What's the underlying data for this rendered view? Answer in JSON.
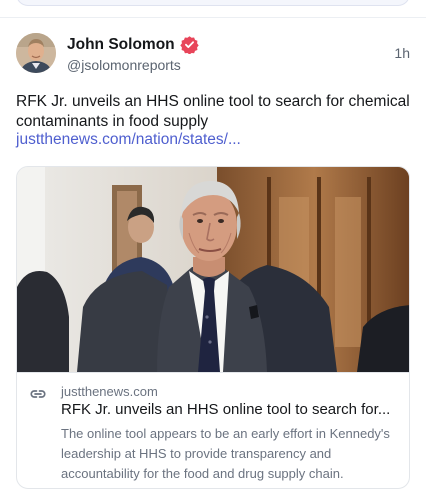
{
  "post": {
    "author_name": "John Solomon",
    "author_handle": "@jsolomonreports",
    "timestamp": "1h",
    "text": "RFK Jr. unveils an HHS online tool to search for chemical contaminants in food supply",
    "link_text": "justthenews.com/nation/states/..."
  },
  "link_card": {
    "domain": "justthenews.com",
    "title": "RFK Jr. unveils an HHS online tool to search for...",
    "description": "The online tool appears to be an early effort in Kennedy's leadership at HHS to provide transparency and accountability for the food and drug supply chain."
  },
  "colors": {
    "accent": "#4f5fcf",
    "verified_badge": "#e8455a",
    "muted_text": "#5b6470"
  },
  "icons": {
    "verified": "verified-badge-icon",
    "link": "link-icon"
  }
}
